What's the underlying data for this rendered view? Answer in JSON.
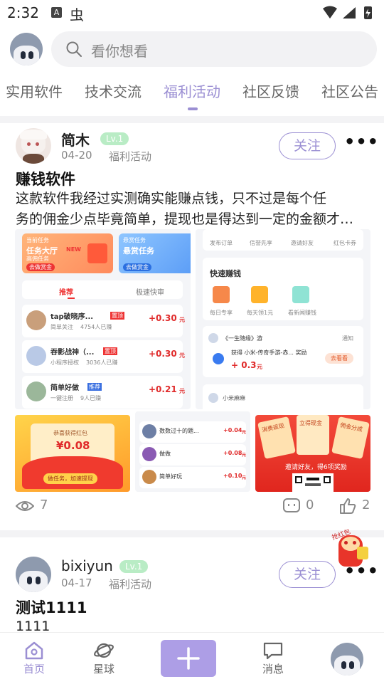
{
  "status_bar": {
    "time": "2:32",
    "notif_a": "A",
    "notif_bug": "虫"
  },
  "search": {
    "placeholder": "看你想看"
  },
  "tabs": [
    {
      "label": "实用软件",
      "active": false
    },
    {
      "label": "技术交流",
      "active": false
    },
    {
      "label": "福利活动",
      "active": true
    },
    {
      "label": "社区反馈",
      "active": false
    },
    {
      "label": "社区公告",
      "active": false
    }
  ],
  "colors": {
    "accent": "#9b8fd3",
    "plus_button": "#ad9ee6",
    "level_badge": "#b9ecc5",
    "price_red": "#e02b2b"
  },
  "posts": [
    {
      "author": "简木",
      "level": "Lv.1",
      "date": "04-20",
      "category": "福利活动",
      "follow_label": "关注",
      "title": "赚钱软件",
      "body_line1": "这款软件我经过实测确实能赚点钱，只不过是每个任",
      "body_line2": "务的佣金少点毕竟简单，提现也是得达到一定的金额才能提现",
      "views": "7",
      "comments": "0",
      "likes": "2",
      "images": {
        "img1": {
          "top_left_card_small": "当前任务",
          "top_left_card_title": "任务大厅",
          "top_left_card_new": "NEW",
          "top_left_card_sub": "高佣任务",
          "top_left_card_btn": "去做赏金",
          "top_right_card_small": "悬赏任务",
          "top_right_card_title": "悬赏任务",
          "top_right_card_btn": "去做赏金",
          "tab_recommend": "推荐",
          "tab_fast": "极速快审",
          "rows": [
            {
              "name": "tap破晓序...",
              "tag": "置顶",
              "sub": "简单关注",
              "count": "4754人已赚",
              "price": "+0.30",
              "unit": "元"
            },
            {
              "name": "吞影战神（...",
              "tag": "置顶",
              "sub": "小程序授权",
              "count": "3036人已赚",
              "price": "+0.30",
              "unit": "元"
            },
            {
              "name": "简单好做",
              "tag": "推荐",
              "sub": "一键注册",
              "count": "9人已赚",
              "price": "+0.21",
              "unit": "元"
            }
          ]
        },
        "img2": {
          "top_icons": [
            "发布订单",
            "信誉先享",
            "邀请好友",
            "红包卡券"
          ],
          "section_title": "快速赚钱",
          "quick": [
            "每日专享",
            "每天领1元",
            "看新闻赚钱"
          ],
          "notice_title": "《一生随缘》游",
          "notice_tag": "通知",
          "notice_text": "获得 小米-传奇手游-赤... 奖励",
          "notice_amount": "+ 0.3",
          "notice_unit": "元",
          "notice_btn": "去看看",
          "footer_user": "小米麻麻"
        },
        "img3": {
          "title": "恭喜获得红包",
          "amount": "¥0.08",
          "btn": "做任务，加速提现"
        },
        "img4": {
          "rows": [
            {
              "name": "数数过十的题...",
              "price": "+0.04",
              "unit": "元"
            },
            {
              "name": "做做",
              "price": "+0.08",
              "unit": "元"
            },
            {
              "name": "简单好玩",
              "price": "+0.10",
              "unit": "元"
            }
          ]
        },
        "img5": {
          "card1": "消费返现",
          "card2": "立得现金",
          "card3": "佣金分成",
          "banner": "邀请好友，得6项奖励"
        }
      }
    },
    {
      "author": "bixiyun",
      "level": "Lv.1",
      "date": "04-17",
      "category": "福利活动",
      "follow_label": "关注",
      "title": "测试1111",
      "body_line1": "1111"
    }
  ],
  "floating_badge": {
    "text": "抢红包"
  },
  "bottom_nav": [
    {
      "label": "首页",
      "active": true,
      "icon": "home-icon"
    },
    {
      "label": "星球",
      "active": false,
      "icon": "planet-icon"
    },
    {
      "label": "",
      "active": false,
      "icon": "plus-icon"
    },
    {
      "label": "消息",
      "active": false,
      "icon": "message-icon"
    },
    {
      "label": "",
      "active": false,
      "icon": "avatar"
    }
  ]
}
